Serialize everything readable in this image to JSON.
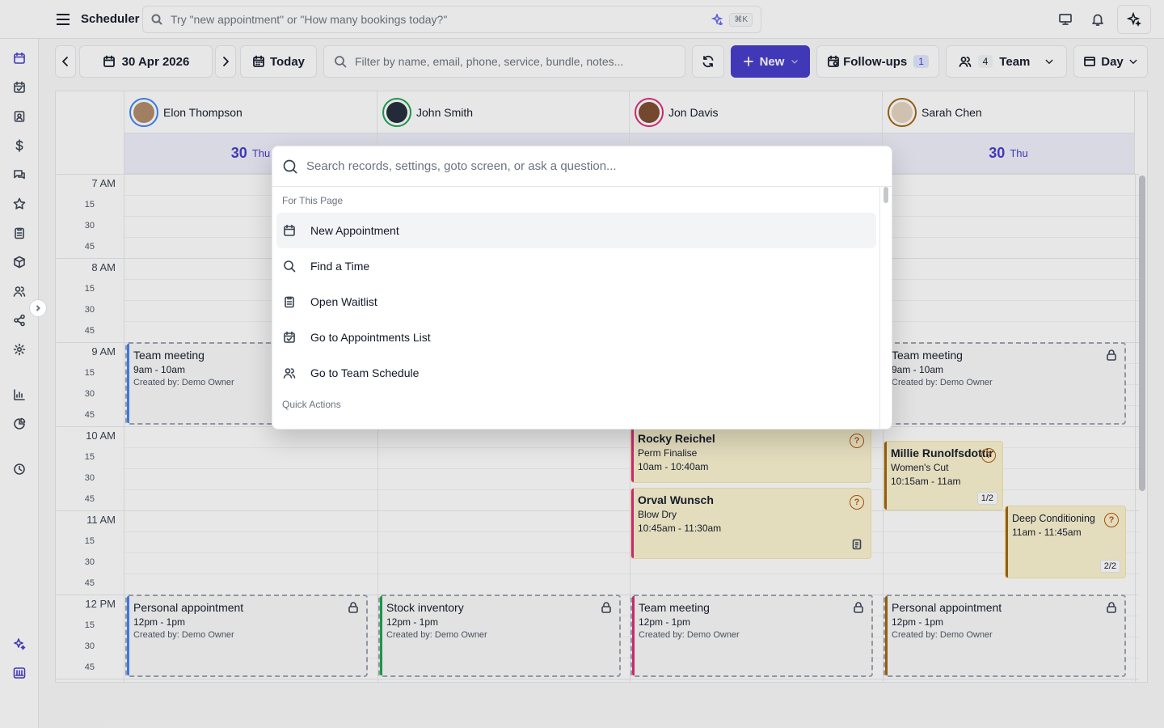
{
  "app": {
    "title": "Scheduler"
  },
  "global_search": {
    "placeholder": "Try \"new appointment\" or \"How many bookings today?\"",
    "shortcut": "⌘K"
  },
  "toolbar": {
    "date": "30 Apr 2026",
    "today_label": "Today",
    "filter_placeholder": "Filter by name, email, phone, service, bundle, notes...",
    "new_label": "New",
    "followups_label": "Follow-ups",
    "followups_count": "1",
    "team_count": "4",
    "team_label": "Team",
    "view_label": "Day"
  },
  "staff": [
    {
      "name": "Elon Thompson",
      "ring": "#3b82f6"
    },
    {
      "name": "John Smith",
      "ring": "#16a34a"
    },
    {
      "name": "Jon Davis",
      "ring": "#db2777"
    },
    {
      "name": "Sarah Chen",
      "ring": "#a16207"
    }
  ],
  "day": {
    "num": "30",
    "dow": "Thu"
  },
  "time_labels": {
    "hours": [
      "7 AM",
      "8 AM",
      "9 AM",
      "10 AM",
      "11 AM",
      "12 PM"
    ],
    "minutes": [
      "15",
      "30",
      "45"
    ]
  },
  "events": [
    {
      "title": "Team meeting",
      "time": "9am - 10am",
      "created": "Created by: Demo Owner"
    },
    {
      "title": "Team meeting",
      "time": "9am - 10am",
      "created": "Created by: Demo Owner"
    },
    {
      "title": "Rocky Reichel",
      "service": "Perm Finalise",
      "time": "10am - 10:40am"
    },
    {
      "title": "Orval Wunsch",
      "service": "Blow Dry",
      "time": "10:45am - 11:30am"
    },
    {
      "title": "Millie Runolfsdottir",
      "service": "Women's Cut",
      "time": "10:15am - 11am",
      "ratio": "1/2"
    },
    {
      "title": "Deep Conditioning",
      "time": "11am - 11:45am",
      "ratio": "2/2"
    },
    {
      "title": "Personal appointment",
      "time": "12pm - 1pm",
      "created": "Created by: Demo Owner"
    },
    {
      "title": "Stock inventory",
      "time": "12pm - 1pm",
      "created": "Created by: Demo Owner"
    },
    {
      "title": "Team meeting",
      "time": "12pm - 1pm",
      "created": "Created by: Demo Owner"
    },
    {
      "title": "Personal appointment",
      "time": "12pm - 1pm",
      "created": "Created by: Demo Owner"
    }
  ],
  "palette": {
    "placeholder": "Search records, settings, goto screen, or ask a question...",
    "section_page": "For This Page",
    "items": [
      "New Appointment",
      "Find a Time",
      "Open Waitlist",
      "Go to Appointments List",
      "Go to Team Schedule"
    ],
    "section_quick": "Quick Actions"
  },
  "colors": {
    "accent": "#4338ca",
    "booked_bg": "#fbf3d0"
  }
}
